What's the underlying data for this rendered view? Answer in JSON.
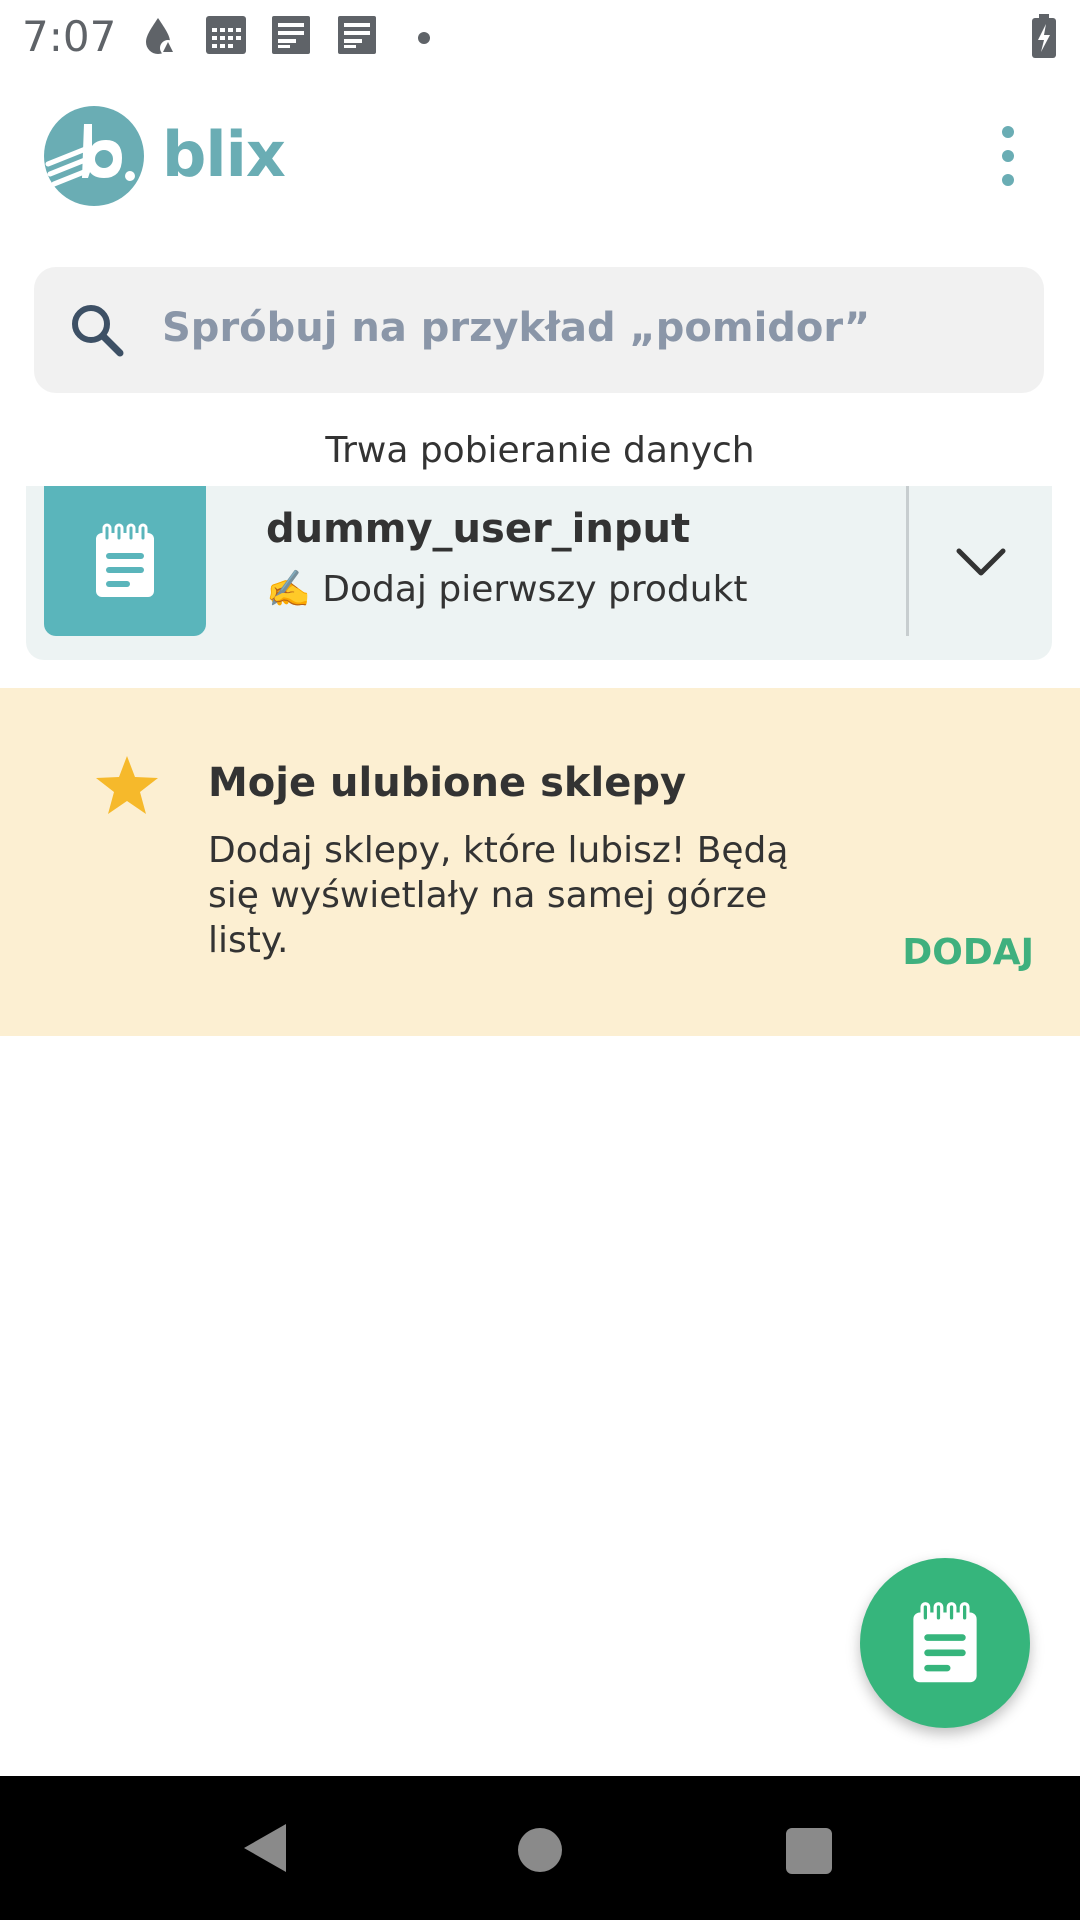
{
  "status_bar": {
    "time": "7:07",
    "icons": [
      "drop-icon",
      "calendar-icon",
      "news-icon",
      "news-icon",
      "dot",
      "battery-charging-icon"
    ]
  },
  "app_bar": {
    "brand": "blix",
    "menu_icon": "more-vertical-icon"
  },
  "search": {
    "placeholder": "Spróbuj na przykład „pomidor”",
    "icon": "search-icon"
  },
  "loading_text": "Trwa pobieranie danych",
  "list_card": {
    "title": "dummy_user_input",
    "subtitle": "✍️ Dodaj pierwszy produkt",
    "icon": "notepad-icon",
    "expand_icon": "chevron-down-icon"
  },
  "favorites": {
    "title": "Moje ulubione sklepy",
    "description": "Dodaj sklepy, które lubisz! Będą się wyświetlały na samej górze listy.",
    "action": "DODAJ",
    "icon": "star-icon"
  },
  "fab": {
    "icon": "notepad-icon"
  },
  "nav_bar": {
    "back": "back-icon",
    "home": "home-icon",
    "recents": "recents-icon"
  },
  "colors": {
    "brand_teal": "#6aadb4",
    "thumb_teal": "#5ab5bb",
    "accent_green": "#36b57c",
    "banner_bg": "#fcefd2",
    "star": "#f6b92b"
  }
}
